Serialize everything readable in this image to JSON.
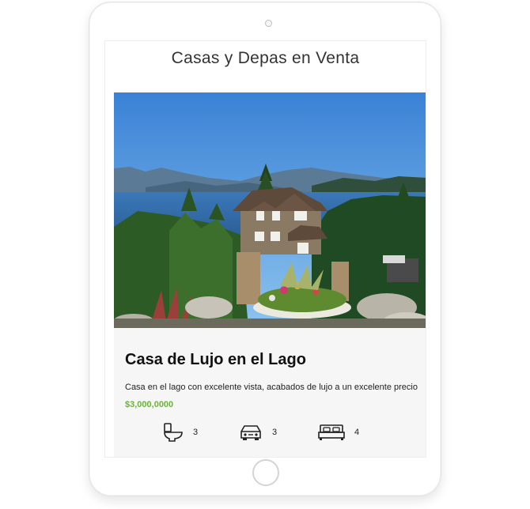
{
  "page": {
    "title": "Casas y Depas en Venta"
  },
  "listing": {
    "photo_alt": "Casa de lujo junto al lago",
    "title": "Casa de Lujo en el Lago",
    "description": "Casa en el lago con excelente vista, acabados de lujo a un excelente precio",
    "price": "$3,000,0000",
    "price_color": "#6bb33a",
    "amenities": [
      {
        "icon": "toilet-icon",
        "count": "3"
      },
      {
        "icon": "car-icon",
        "count": "3"
      },
      {
        "icon": "bed-icon",
        "count": "4"
      }
    ]
  }
}
